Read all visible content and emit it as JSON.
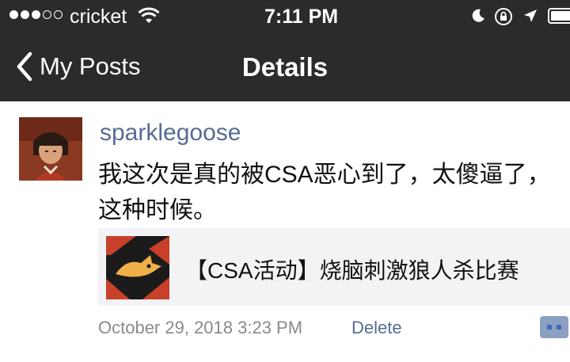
{
  "status_bar": {
    "carrier": "cricket",
    "time": "7:11 PM",
    "signal_bars_filled": 3,
    "signal_bars_total": 5,
    "icons": [
      "wifi-icon",
      "moon-icon",
      "rotation-lock-icon",
      "location-icon",
      "battery-icon"
    ]
  },
  "nav": {
    "back_label": "My Posts",
    "title": "Details"
  },
  "post": {
    "username": "sparklegoose",
    "text": "我这次是真的被CSA恶心到了，太傻逼了，这种时候。",
    "link": {
      "title": "【CSA活动】烧脑刺激狼人杀比赛",
      "thumbnail_icon": "werewolf-logo-icon"
    },
    "timestamp": "October 29, 2018 3:23 PM",
    "delete_label": "Delete"
  },
  "colors": {
    "nav_background": "#2b2b2e",
    "username": "#576b95",
    "link_card_background": "#f3f3f5",
    "thumbnail_red": "#c8402a"
  }
}
